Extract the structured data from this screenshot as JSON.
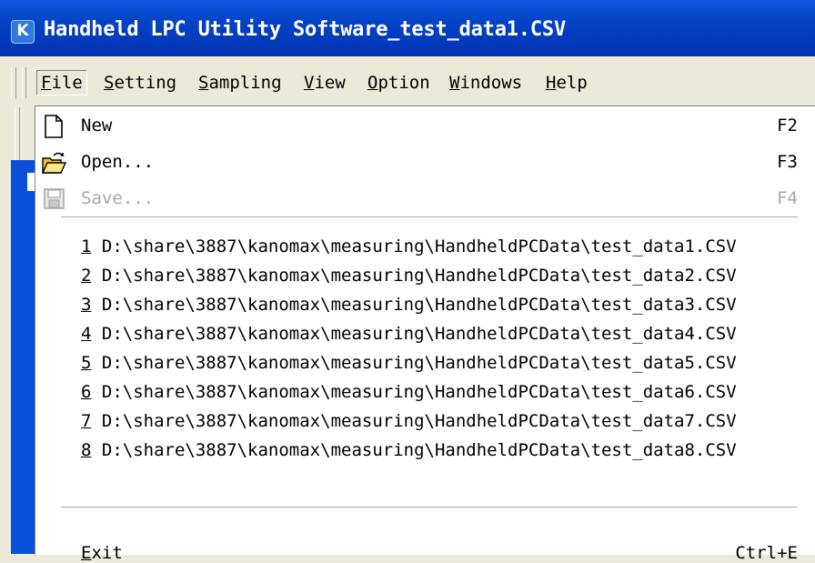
{
  "window": {
    "title": "Handheld LPC Utility Software_test_data1.CSV"
  },
  "menubar": [
    {
      "accel": "F",
      "rest": "ile"
    },
    {
      "accel": "S",
      "rest": "etting"
    },
    {
      "accel": "S",
      "rest": "ampling"
    },
    {
      "accel": "V",
      "rest": "iew"
    },
    {
      "accel": "O",
      "rest": "ption"
    },
    {
      "accel": "W",
      "rest": "indows"
    },
    {
      "accel": "H",
      "rest": "elp"
    }
  ],
  "file_menu": {
    "new": {
      "label": "New",
      "shortcut": "F2",
      "icon": "new-document-icon"
    },
    "open": {
      "label": "Open...",
      "shortcut": "F3",
      "icon": "open-folder-icon"
    },
    "save": {
      "label": "Save...",
      "shortcut": "F4",
      "icon": "save-disk-icon",
      "disabled": true
    },
    "recent": [
      {
        "num": "1",
        "path": "D:\\share\\3887\\kanomax\\measuring\\HandheldPCData\\test_data1.CSV"
      },
      {
        "num": "2",
        "path": "D:\\share\\3887\\kanomax\\measuring\\HandheldPCData\\test_data2.CSV"
      },
      {
        "num": "3",
        "path": "D:\\share\\3887\\kanomax\\measuring\\HandheldPCData\\test_data3.CSV"
      },
      {
        "num": "4",
        "path": "D:\\share\\3887\\kanomax\\measuring\\HandheldPCData\\test_data4.CSV"
      },
      {
        "num": "5",
        "path": "D:\\share\\3887\\kanomax\\measuring\\HandheldPCData\\test_data5.CSV"
      },
      {
        "num": "6",
        "path": "D:\\share\\3887\\kanomax\\measuring\\HandheldPCData\\test_data6.CSV"
      },
      {
        "num": "7",
        "path": "D:\\share\\3887\\kanomax\\measuring\\HandheldPCData\\test_data7.CSV"
      },
      {
        "num": "8",
        "path": "D:\\share\\3887\\kanomax\\measuring\\HandheldPCData\\test_data8.CSV"
      }
    ],
    "exit": {
      "accel": "E",
      "rest": "xit",
      "shortcut": "Ctrl+E"
    }
  },
  "colors": {
    "titlebar": "#0542c4",
    "menu_bg": "#ece9d8",
    "disabled": "#a8a8a8"
  }
}
